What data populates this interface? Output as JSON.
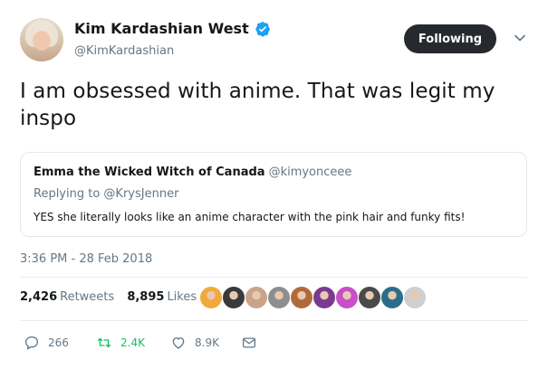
{
  "author": {
    "display_name": "Kim Kardashian West",
    "handle": "@KimKardashian",
    "verified": true
  },
  "follow_button": {
    "label": "Following"
  },
  "tweet": {
    "text": "I am obsessed with anime. That was legit my inspo"
  },
  "quoted_tweet": {
    "display_name": "Emma the Wicked Witch of Canada",
    "handle": "@kimyonceee",
    "replying_to": "Replying to @KrysJenner",
    "text": "YES she literally looks like an anime character with the pink hair and funky fits!"
  },
  "timestamp": "3:36 PM - 28 Feb 2018",
  "stats": {
    "retweets_count": "2,426",
    "retweets_label": "Retweets",
    "likes_count": "8,895",
    "likes_label": "Likes"
  },
  "likers": {
    "count": 10,
    "colors": [
      "#f2a93b",
      "#3a3a3a",
      "#c9a38a",
      "#8e8e8e",
      "#b06b3a",
      "#7a3b8f",
      "#c84fc8",
      "#4a4a4a",
      "#2b6e8a",
      "#cfcfcf"
    ]
  },
  "actions": {
    "reply_count": "266",
    "retweet_count": "2.4K",
    "like_count": "8.9K"
  },
  "colors": {
    "secondary_text": "#657786",
    "verified_blue": "#1da1f2",
    "retweet_green": "#17bf63",
    "button_dark": "#262a2e",
    "border": "#e1e8ed"
  }
}
